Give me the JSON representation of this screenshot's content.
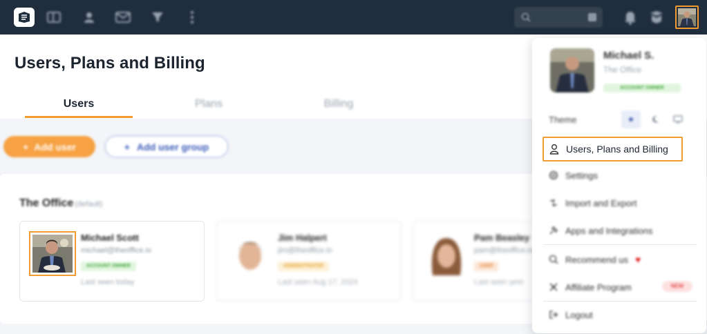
{
  "page": {
    "title": "Users, Plans and Billing",
    "tabs": [
      {
        "label": "Users",
        "active": true
      },
      {
        "label": "Plans",
        "active": false
      },
      {
        "label": "Billing",
        "active": false
      }
    ]
  },
  "actions": {
    "add_user": "Add user",
    "add_user_group": "Add user group"
  },
  "group": {
    "name": "The Office",
    "tag": "(default)"
  },
  "users": [
    {
      "name": "Michael Scott",
      "email": "michael@theoffice.io",
      "badge": "ACCOUNT OWNER",
      "badge_color": "#3fa33a",
      "badge_bg": "#e2f6df",
      "last_seen": "Last seen today"
    },
    {
      "name": "Jim Halpert",
      "email": "jim@theoffice.io",
      "badge": "ADMINISTRATOR",
      "badge_color": "#e39a1e",
      "badge_bg": "#fdf0d6",
      "last_seen": "Last seen Aug 17, 2024"
    },
    {
      "name": "Pam Beasley",
      "email": "pam@theoffice.io",
      "badge": "USER",
      "badge_color": "#e07a2e",
      "badge_bg": "#fde6d6",
      "last_seen": "Last seen yest"
    }
  ],
  "menu": {
    "user_name": "Michael S.",
    "org": "The Office",
    "badge": "ACCOUNT OWNER",
    "theme_label": "Theme",
    "items": [
      {
        "label": "Users, Plans and Billing",
        "icon": "user-icon"
      },
      {
        "label": "Settings",
        "icon": "gear-icon"
      },
      {
        "label": "Import and Export",
        "icon": "import-export-icon"
      },
      {
        "label": "Apps and Integrations",
        "icon": "plug-icon"
      },
      {
        "label": "Recommend us",
        "icon": "megaphone-icon"
      },
      {
        "label": "Affiliate Program",
        "icon": "affiliate-icon",
        "badge": "NEW"
      },
      {
        "label": "Logout",
        "icon": "logout-icon"
      }
    ]
  },
  "colors": {
    "topbar": "#1f2d3d",
    "accent": "#f29b30",
    "primary_button": "#f6a142",
    "link_blue": "#3b5bb8"
  }
}
